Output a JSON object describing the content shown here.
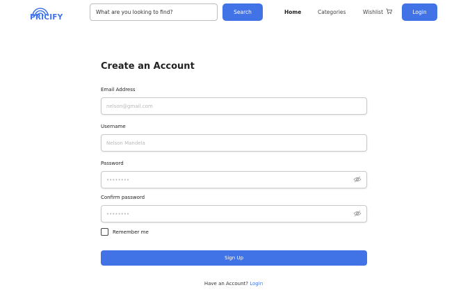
{
  "brand": {
    "name": "PRICIFY",
    "color": "#3f73e8"
  },
  "header": {
    "search_placeholder": "What are you looking to find?",
    "search_button": "Search",
    "nav": {
      "home": "Home",
      "categories": "Categories",
      "wishlist": "Wishlist"
    },
    "cart_icon": "cart-icon",
    "login_button": "Login"
  },
  "form": {
    "title": "Create an Account",
    "email": {
      "label": "Email Address",
      "placeholder": "nelson@gmail.com"
    },
    "username": {
      "label": "Username",
      "placeholder": "Nelson Mandela"
    },
    "password": {
      "label": "Password",
      "placeholder": "••••••••",
      "icon": "eye-slash-icon"
    },
    "confirm": {
      "label": "Confirm password",
      "placeholder": "••••••••",
      "icon": "eye-slash-icon"
    },
    "remember_label": "Remember me",
    "signup_button": "Sign Up",
    "have_account_text": "Have an Account?",
    "login_link": "Login"
  },
  "colors": {
    "accent": "#4273e6",
    "border": "#c8c8c8"
  }
}
